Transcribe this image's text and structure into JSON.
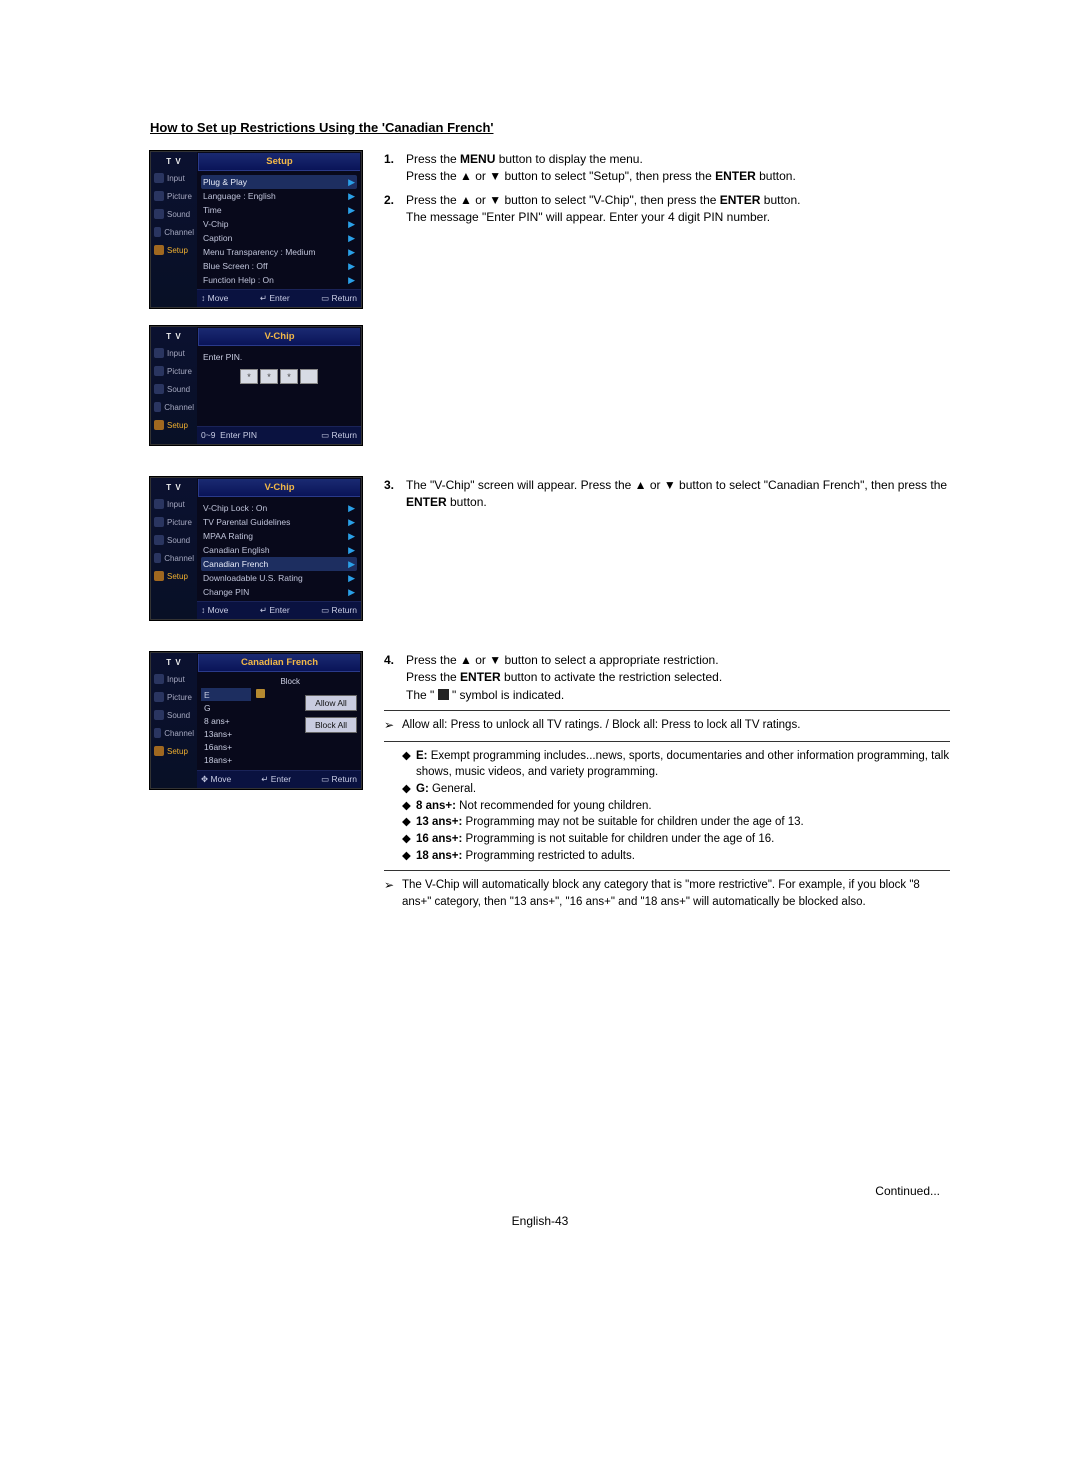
{
  "title": "How to Set up Restrictions Using the 'Canadian French'",
  "sidebar": {
    "header": "T V",
    "items": [
      "Input",
      "Picture",
      "Sound",
      "Channel",
      "Setup"
    ],
    "active_index": 4
  },
  "screens": {
    "setup": {
      "title": "Setup",
      "rows": [
        {
          "label": "Plug & Play",
          "value": "",
          "hl": true
        },
        {
          "label": "Language",
          "value": ": English"
        },
        {
          "label": "Time",
          "value": ""
        },
        {
          "label": "V-Chip",
          "value": ""
        },
        {
          "label": "Caption",
          "value": ""
        },
        {
          "label": "Menu Transparency",
          "value": ": Medium"
        },
        {
          "label": "Blue Screen",
          "value": ": Off"
        },
        {
          "label": "Function Help",
          "value": ": On"
        }
      ],
      "footer": {
        "left": "Move",
        "mid": "Enter",
        "right": "Return",
        "left_icon": "↕",
        "mid_icon": "↵",
        "right_icon": "▭"
      }
    },
    "vchip_pin": {
      "title": "V-Chip",
      "prompt": "Enter PIN.",
      "pin": [
        "*",
        "*",
        "*",
        ""
      ],
      "footer": {
        "left": "0~9",
        "mid": "Enter PIN",
        "right": "Return",
        "right_icon": "▭"
      }
    },
    "vchip_menu": {
      "title": "V-Chip",
      "rows": [
        {
          "label": "V-Chip Lock",
          "value": ": On"
        },
        {
          "label": "TV Parental Guidelines",
          "value": ""
        },
        {
          "label": "MPAA Rating",
          "value": ""
        },
        {
          "label": "Canadian English",
          "value": ""
        },
        {
          "label": "Canadian French",
          "value": "",
          "hl": true
        },
        {
          "label": "Downloadable U.S. Rating",
          "value": ""
        },
        {
          "label": "Change PIN",
          "value": ""
        }
      ],
      "footer": {
        "left": "Move",
        "mid": "Enter",
        "right": "Return",
        "left_icon": "↕",
        "mid_icon": "↵",
        "right_icon": "▭"
      }
    },
    "canadian_french": {
      "title": "Canadian French",
      "col_head": "Block",
      "rows": [
        {
          "label": "E",
          "locked": true,
          "hl": true
        },
        {
          "label": "G",
          "locked": false
        },
        {
          "label": "8 ans+",
          "locked": false
        },
        {
          "label": "13ans+",
          "locked": false
        },
        {
          "label": "16ans+",
          "locked": false
        },
        {
          "label": "18ans+",
          "locked": false
        }
      ],
      "allow": "Allow All",
      "block": "Block All",
      "footer": {
        "left": "Move",
        "mid": "Enter",
        "right": "Return",
        "left_icon": "✥",
        "mid_icon": "↵",
        "right_icon": "▭"
      }
    }
  },
  "instructions": {
    "s1": {
      "num": "1.",
      "a": "Press the ",
      "b": "MENU",
      "c": " button to display the menu.",
      "d": "Press the ▲ or ▼ button to select \"Setup\", then press the ",
      "e": "ENTER",
      "f": " button."
    },
    "s2": {
      "num": "2.",
      "a": "Press the ▲ or ▼ button to select \"V-Chip\", then press the ",
      "b": "ENTER",
      "c": " button.",
      "d": "The message \"Enter PIN\" will appear. Enter your 4 digit PIN number."
    },
    "s3": {
      "num": "3.",
      "a": "The \"V-Chip\" screen will appear. Press the ▲ or ▼ button to select \"Canadian French\", then press the ",
      "b": "ENTER",
      "c": " button."
    },
    "s4": {
      "num": "4.",
      "a": "Press the ▲ or ▼ button to select a appropriate restriction.",
      "b": "Press the ",
      "c": "ENTER",
      "d": " button to activate the restriction selected.",
      "e": "The \" ",
      "f": " \" symbol is indicated."
    },
    "note1": "Allow all: Press to unlock all TV ratings. / Block all: Press to lock all TV ratings.",
    "ratings": {
      "e1": "E:",
      "e2": " Exempt programming includes...news, sports, documentaries and other information programming, talk shows, music videos, and variety programming.",
      "g1": "G:",
      "g2": " General.",
      "a8_1": "8 ans+:",
      "a8_2": " Not recommended for young children.",
      "a13_1": "13 ans+:",
      "a13_2": " Programming may not be suitable for children under the age of 13.",
      "a16_1": "16 ans+:",
      "a16_2": " Programming is not suitable for children under the age of 16.",
      "a18_1": "18 ans+:",
      "a18_2": " Programming restricted to adults."
    },
    "note2": "The V-Chip will automatically block any category that is \"more restrictive\". For example, if you block \"8 ans+\" category, then \"13 ans+\", \"16 ans+\" and \"18 ans+\" will automatically be blocked also."
  },
  "continued": "Continued...",
  "page_num": "English-43"
}
